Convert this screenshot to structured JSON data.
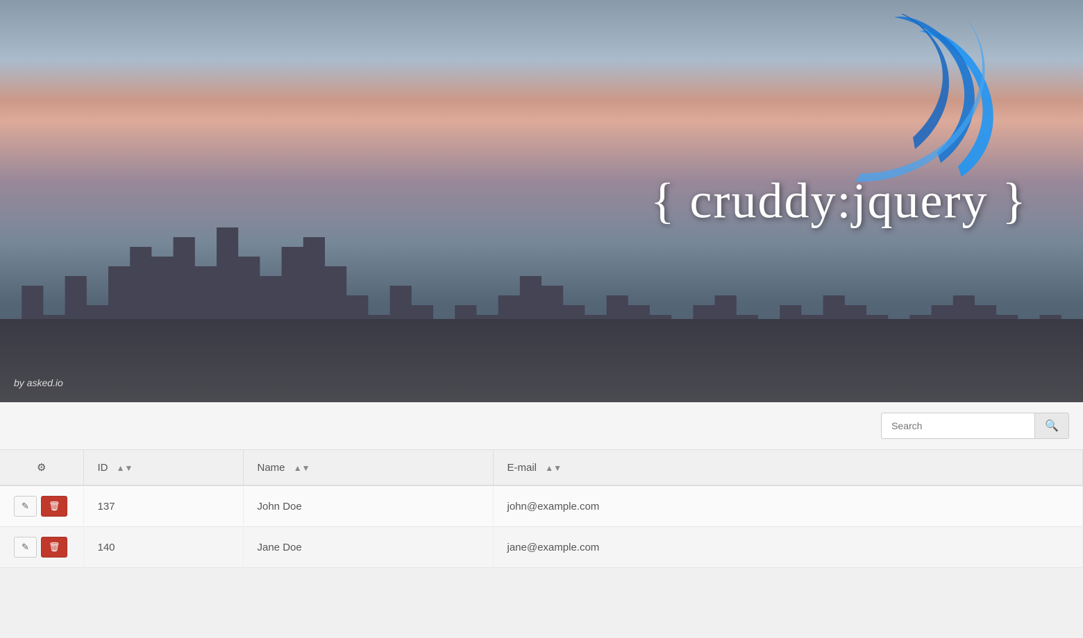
{
  "hero": {
    "brand_title": "{ cruddy:jquery }",
    "attribution": "by asked.io"
  },
  "toolbar": {
    "search_placeholder": "Search",
    "search_button_label": "🔍"
  },
  "table": {
    "columns": [
      {
        "key": "settings",
        "label": "",
        "sortable": false
      },
      {
        "key": "id",
        "label": "ID",
        "sortable": true
      },
      {
        "key": "name",
        "label": "Name",
        "sortable": true
      },
      {
        "key": "email",
        "label": "E-mail",
        "sortable": true
      }
    ],
    "rows": [
      {
        "id": "137",
        "name": "John Doe",
        "email": "john@example.com"
      },
      {
        "id": "140",
        "name": "Jane Doe",
        "email": "jane@example.com"
      }
    ],
    "actions": {
      "edit_label": "✏",
      "delete_label": "🗑"
    }
  }
}
